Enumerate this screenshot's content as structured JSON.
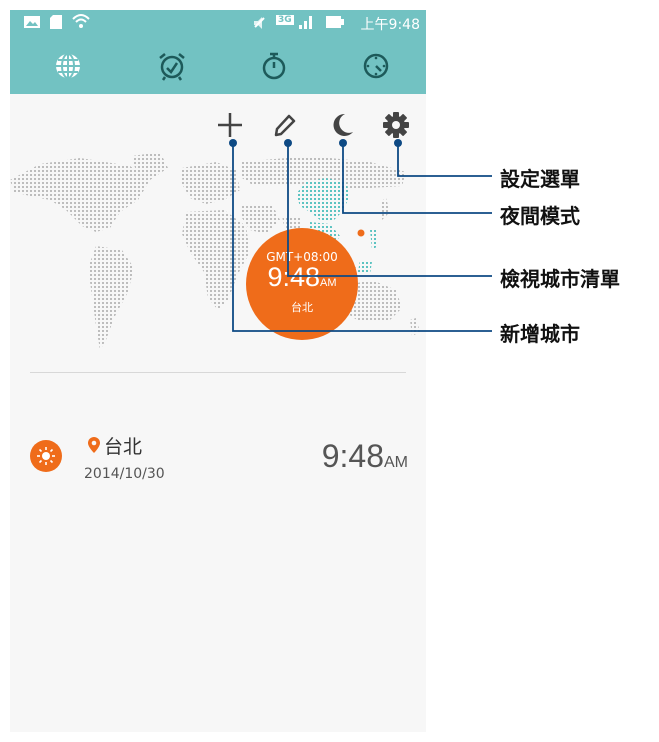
{
  "status_bar": {
    "network": "3G",
    "time": "上午9:48",
    "icons": [
      "image-icon",
      "sd-card-icon",
      "wifi-icon",
      "mute-icon",
      "signal-icon",
      "battery-icon"
    ]
  },
  "tabs": [
    {
      "name": "world-clock",
      "icon": "globe-icon",
      "selected": true
    },
    {
      "name": "alarm",
      "icon": "alarm-clock-icon",
      "selected": false
    },
    {
      "name": "stopwatch",
      "icon": "stopwatch-icon",
      "selected": false
    },
    {
      "name": "timer",
      "icon": "timer-icon",
      "selected": false
    }
  ],
  "actions": [
    {
      "name": "add-city",
      "icon": "plus-icon"
    },
    {
      "name": "edit-city-list",
      "icon": "pencil-icon"
    },
    {
      "name": "night-mode",
      "icon": "moon-icon"
    },
    {
      "name": "settings-menu",
      "icon": "gear-icon"
    }
  ],
  "clock_bubble": {
    "gmt": "GMT+08:00",
    "time": "9:48",
    "ampm": "AM",
    "city": "台北"
  },
  "city_list": [
    {
      "name": "台北",
      "date": "2014/10/30",
      "time": "9:48",
      "ampm": "AM",
      "icon": "sun-icon"
    }
  ],
  "callouts": {
    "settings": "設定選單",
    "night_mode": "夜間模式",
    "view_list": "檢視城市清單",
    "add_city": "新增城市"
  },
  "colors": {
    "header": "#72c2c2",
    "accent": "#ef6c1a",
    "callout_line": "#0e4a84"
  }
}
